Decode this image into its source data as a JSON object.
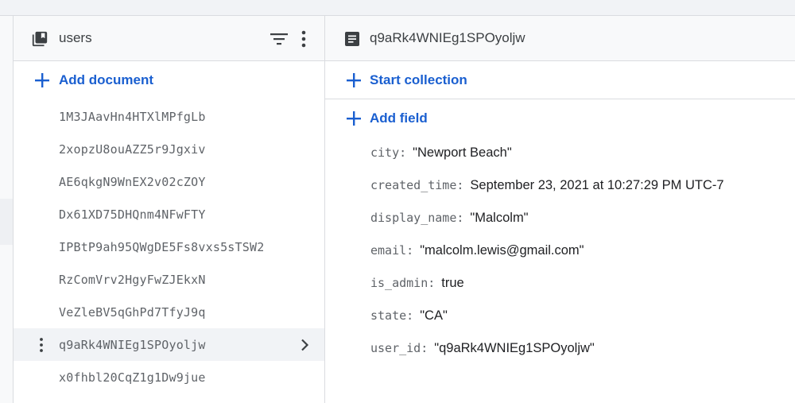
{
  "collection": {
    "title": "users",
    "add_document_label": "Add document",
    "documents": [
      "1M3JAavHn4HTXlMPfgLb",
      "2xopzU8ouAZZ5r9Jgxiv",
      "AE6qkgN9WnEX2v02cZOY",
      "Dx61XD75DHQnm4NFwFTY",
      "IPBtP9ah95QWgDE5Fs8vxs5sTSW2",
      "RzComVrv2HgyFwZJEkxN",
      "VeZleBV5qGhPd7TfyJ9q",
      "q9aRk4WNIEg1SPOyoljw",
      "x0fhbl20CqZ1g1Dw9jue"
    ],
    "selected_index": 7
  },
  "document": {
    "title": "q9aRk4WNIEg1SPOyoljw",
    "start_collection_label": "Start collection",
    "add_field_label": "Add field",
    "fields": [
      {
        "key": "city",
        "value": "\"Newport Beach\""
      },
      {
        "key": "created_time",
        "value": "September 23, 2021 at 10:27:29 PM UTC-7"
      },
      {
        "key": "display_name",
        "value": "\"Malcolm\""
      },
      {
        "key": "email",
        "value": "\"malcolm.lewis@gmail.com\""
      },
      {
        "key": "is_admin",
        "value": "true"
      },
      {
        "key": "state",
        "value": "\"CA\""
      },
      {
        "key": "user_id",
        "value": "\"q9aRk4WNIEg1SPOyoljw\""
      }
    ]
  },
  "icons": {
    "collection": "collection-icon",
    "filter": "filter-icon",
    "more": "more-vert-icon",
    "document": "document-icon",
    "add": "plus-icon",
    "chevron": "chevron-right-icon"
  },
  "colors": {
    "accent": "#1a5fd0",
    "header_bg": "#f8f9fa",
    "selected_bg": "#f1f3f6",
    "icon": "#3c4043"
  }
}
